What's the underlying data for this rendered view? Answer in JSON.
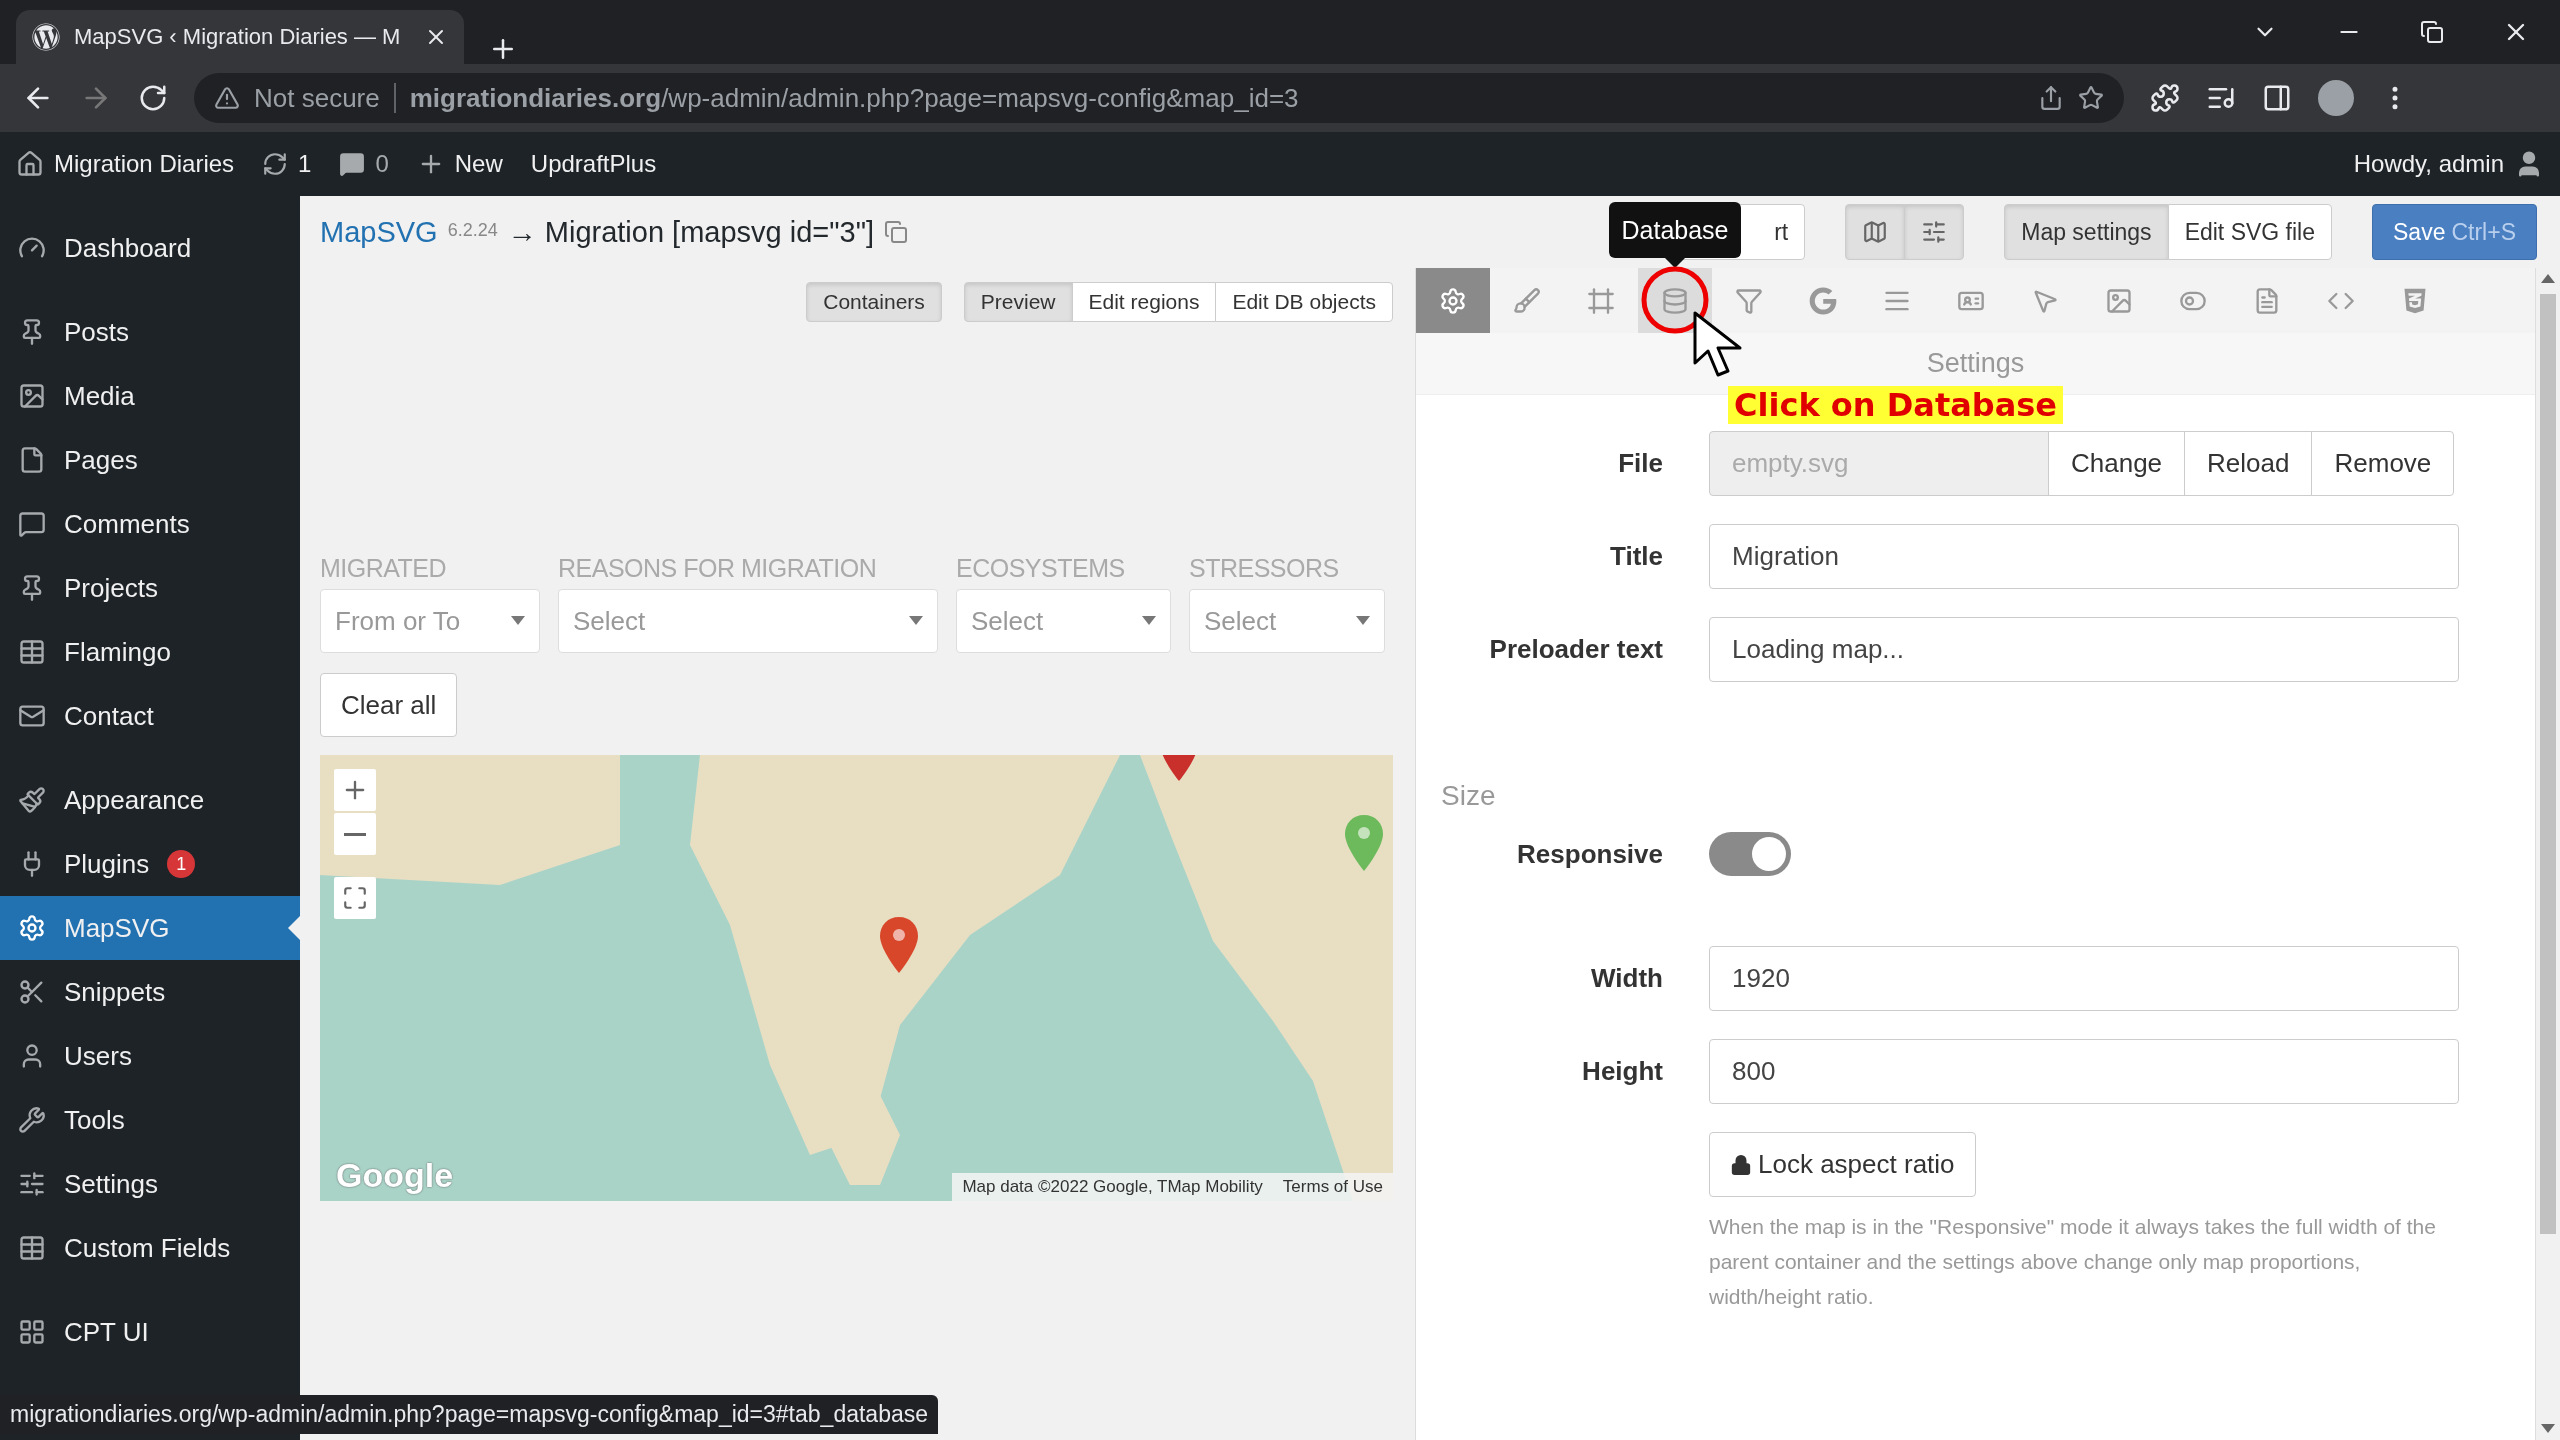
{
  "browser": {
    "tab_title": "MapSVG ‹ Migration Diaries — M",
    "security": "Not secure",
    "url": "**migrationdiaries.org**/wp-admin/admin.php?page=mapsvg-config&map_id=3"
  },
  "admin_bar": {
    "site": "Migration Diaries",
    "updates": "1",
    "comments": "0",
    "new": "New",
    "plugin": "UpdraftPlus",
    "greeting": "Howdy, admin"
  },
  "sidebar": {
    "groups": [
      [
        {
          "label": "Dashboard",
          "selected": false
        }
      ],
      [
        {
          "label": "Posts",
          "selected": false
        },
        {
          "label": "Media",
          "selected": false
        },
        {
          "label": "Pages",
          "selected": false
        },
        {
          "label": "Comments",
          "selected": false
        },
        {
          "label": "Projects",
          "selected": false
        },
        {
          "label": "Flamingo",
          "selected": false
        },
        {
          "label": "Contact",
          "selected": false
        }
      ],
      [
        {
          "label": "Appearance",
          "selected": false
        },
        {
          "label": "Plugins",
          "selected": false,
          "badge": "1"
        },
        {
          "label": "MapSVG",
          "selected": true
        },
        {
          "label": "Snippets",
          "selected": false
        },
        {
          "label": "Users",
          "selected": false
        },
        {
          "label": "Tools",
          "selected": false
        },
        {
          "label": "Settings",
          "selected": false
        },
        {
          "label": "Custom Fields",
          "selected": false
        }
      ],
      [
        {
          "label": "CPT UI",
          "selected": false
        }
      ]
    ]
  },
  "header": {
    "brand": "MapSVG",
    "version": "6.2.24",
    "title": "→ Migration [mapsvg id=\"3\"]",
    "cut_button": "rt",
    "views": [
      {
        "label": "Map settings",
        "selected": true
      },
      {
        "label": "Edit SVG file",
        "selected": false
      }
    ],
    "save": "Save",
    "save_shortcut": "Ctrl+S",
    "tooltip": "Database"
  },
  "preview": {
    "containers": {
      "label": "Containers",
      "selected": true
    },
    "modes": [
      {
        "label": "Preview",
        "selected": true
      },
      {
        "label": "Edit regions",
        "selected": false
      },
      {
        "label": "Edit DB objects",
        "selected": false
      }
    ],
    "filters": [
      {
        "label": "MIGRATED",
        "placeholder": "From or To"
      },
      {
        "label": "REASONS FOR MIGRATION",
        "placeholder": "Select"
      },
      {
        "label": "ECOSYSTEMS",
        "placeholder": "Select"
      },
      {
        "label": "STRESSORS",
        "placeholder": "Select"
      }
    ],
    "clear": "Clear all",
    "map": {
      "logo": "Google",
      "attribution": "Map data ©2022 Google, TMap Mobility",
      "terms": "Terms of Use"
    }
  },
  "settings": {
    "tools": [
      {
        "selected": true,
        "hovered": false
      },
      {
        "selected": false,
        "hovered": false
      },
      {
        "selected": false,
        "hovered": false
      },
      {
        "selected": false,
        "hovered": true
      },
      {
        "selected": false,
        "hovered": false
      },
      {
        "selected": false,
        "hovered": false
      },
      {
        "selected": false,
        "hovered": false
      },
      {
        "selected": false,
        "hovered": false
      },
      {
        "selected": false,
        "hovered": false
      },
      {
        "selected": false,
        "hovered": false
      },
      {
        "selected": false,
        "hovered": false
      },
      {
        "selected": false,
        "hovered": false
      },
      {
        "selected": false,
        "hovered": false
      },
      {
        "selected": false,
        "hovered": false
      }
    ],
    "heading": "Settings",
    "annotation": "Click on Database",
    "rows": [
      {
        "kind": "file",
        "label": "File",
        "value": "empty.svg",
        "disabled": true,
        "buttons": [
          "Change",
          "Reload",
          "Remove"
        ]
      },
      {
        "kind": "text",
        "label": "Title",
        "value": "Migration"
      },
      {
        "kind": "text",
        "label": "Preloader text",
        "value": "Loading map..."
      },
      {
        "kind": "heading",
        "label": "Size"
      },
      {
        "kind": "toggle",
        "label": "Responsive",
        "on": true
      },
      {
        "kind": "text",
        "label": "Width",
        "value": "1920"
      },
      {
        "kind": "text",
        "label": "Height",
        "value": "800"
      },
      {
        "kind": "button",
        "label": "Lock aspect ratio"
      },
      {
        "kind": "help",
        "label": "When the map is in the \"Responsive\" mode it always takes the full width of the parent container and the settings above change only map proportions, width/height ratio."
      }
    ]
  },
  "status_url": "migrationdiaries.org/wp-admin/admin.php?page=mapsvg-config&map_id=3#tab_database"
}
